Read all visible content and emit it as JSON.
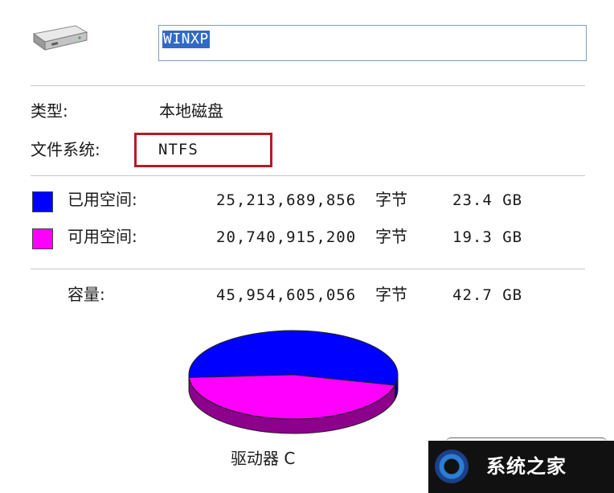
{
  "drive": {
    "name_value": "WINXP",
    "type_label": "类型:",
    "type_value": "本地磁盘",
    "fs_label": "文件系统:",
    "fs_value": "NTFS"
  },
  "usage": {
    "used": {
      "label": "已用空间:",
      "bytes": "25,213,689,856",
      "unit": "字节",
      "size": "23.4 GB",
      "color": "#0000ff"
    },
    "free": {
      "label": "可用空间:",
      "bytes": "20,740,915,200",
      "unit": "字节",
      "size": "19.3 GB",
      "color": "#ff00ff"
    },
    "capacity": {
      "label": "容量:",
      "bytes": "45,954,605,056",
      "unit": "字节",
      "size": "42.7 GB"
    }
  },
  "chart_data": {
    "type": "pie",
    "categories": [
      "已用空间",
      "可用空间"
    ],
    "values": [
      23.4,
      19.3
    ],
    "colors": [
      "#0000ff",
      "#ff00ff"
    ]
  },
  "drive_label": "驱动器 C",
  "watermark": {
    "text": "系统之家"
  },
  "icons": {
    "drive": "hard-drive-icon",
    "logo": "watermark-logo-icon"
  }
}
